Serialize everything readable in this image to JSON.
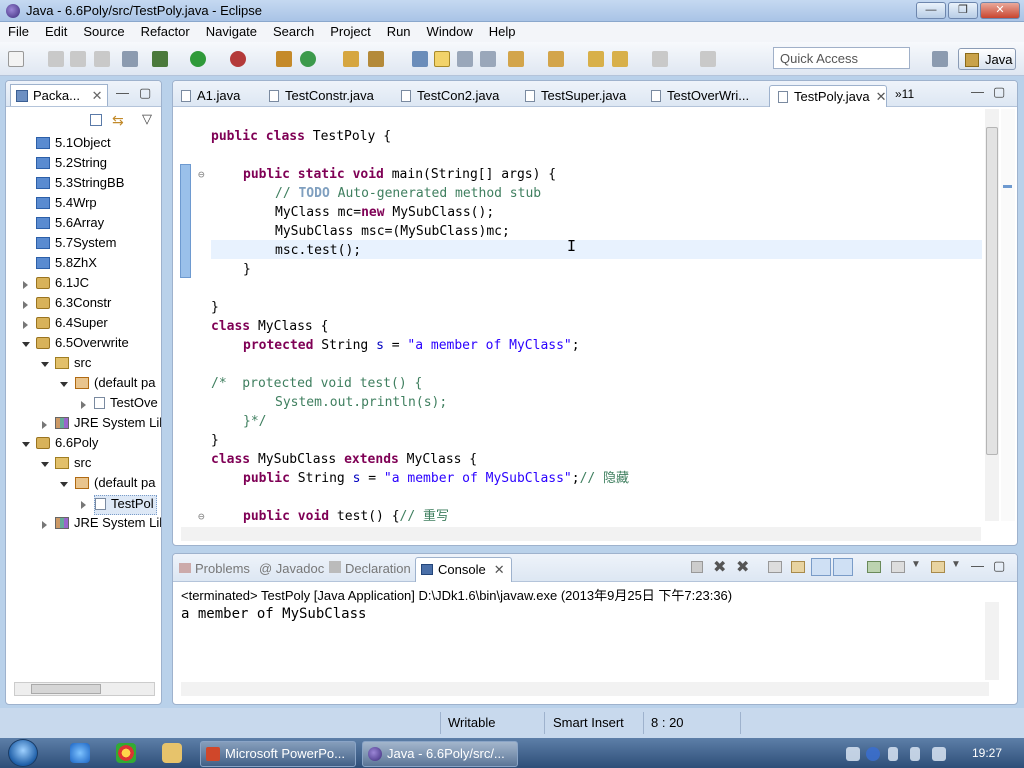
{
  "window": {
    "title": "Java - 6.6Poly/src/TestPoly.java - Eclipse"
  },
  "menu": [
    "File",
    "Edit",
    "Source",
    "Refactor",
    "Navigate",
    "Search",
    "Project",
    "Run",
    "Window",
    "Help"
  ],
  "toolbar": {
    "quick_access_placeholder": "Quick Access",
    "perspective": "Java"
  },
  "package_explorer": {
    "tab_label": "Packa...",
    "items": [
      {
        "label": "5.1Object"
      },
      {
        "label": "5.2String"
      },
      {
        "label": "5.3StringBB"
      },
      {
        "label": "5.4Wrp"
      },
      {
        "label": "5.6Array"
      },
      {
        "label": "5.7System"
      },
      {
        "label": "5.8ZhX"
      },
      {
        "label": "6.1JC"
      },
      {
        "label": "6.3Constr"
      },
      {
        "label": "6.4Super"
      },
      {
        "label": "6.5Overwrite"
      },
      {
        "label": "src"
      },
      {
        "label": "(default pa"
      },
      {
        "label": "TestOve"
      },
      {
        "label": "JRE System Lil"
      },
      {
        "label": "6.6Poly"
      },
      {
        "label": "src"
      },
      {
        "label": "(default pa"
      },
      {
        "label": "TestPol"
      },
      {
        "label": "JRE System Lil"
      }
    ]
  },
  "editor": {
    "tabs": [
      {
        "label": "A1.java"
      },
      {
        "label": "TestConstr.java"
      },
      {
        "label": "TestCon2.java"
      },
      {
        "label": "TestSuper.java"
      },
      {
        "label": "TestOverWri..."
      },
      {
        "label": "TestPoly.java"
      }
    ],
    "overflow_label": "»11",
    "code": {
      "l1a": "public class",
      "l1b": " TestPoly {",
      "l3a": "public static void",
      "l3b": " main(String[] args) {",
      "l4a": "// ",
      "l4b": "TODO",
      "l4c": " Auto-generated method stub",
      "l5a": "MyClass mc=",
      "l5b": "new",
      "l5c": " MySubClass();",
      "l6": "MySubClass msc=(MySubClass)mc;",
      "l7": "msc.test();",
      "l8": "}",
      "l10": "}",
      "l11a": "class",
      "l11b": " MyClass {",
      "l12a": "protected",
      "l12b": " String ",
      "l12c": "s",
      "l12d": " = ",
      "l12e": "\"a member of MyClass\"",
      "l12f": ";",
      "l14": "/*  protected void test() {",
      "l15": "System.out.println(s);",
      "l16": "}*/",
      "l17": "}",
      "l18a": "class",
      "l18b": " MySubClass ",
      "l18c": "extends",
      "l18d": " MyClass {",
      "l19a": "public",
      "l19b": " String ",
      "l19c": "s",
      "l19d": " = ",
      "l19e": "\"a member of MySubClass\"",
      "l19f": ";",
      "l19g": "// 隐藏",
      "l21a": "public void",
      "l21b": " test() {",
      "l21c": "// 重写"
    }
  },
  "console": {
    "tabs": [
      "Problems",
      "@ Javadoc",
      "Declaration",
      "Console"
    ],
    "status": "<terminated> TestPoly [Java Application] D:\\JDk1.6\\bin\\javaw.exe (2013年9月25日 下午7:23:36)",
    "output": "a member of MySubClass"
  },
  "statusbar": {
    "writable": "Writable",
    "insert_mode": "Smart Insert",
    "position": "8 : 20"
  },
  "taskbar": {
    "apps": [
      {
        "label": "Microsoft PowerPo..."
      },
      {
        "label": "Java - 6.6Poly/src/..."
      }
    ],
    "clock": "19:27"
  }
}
